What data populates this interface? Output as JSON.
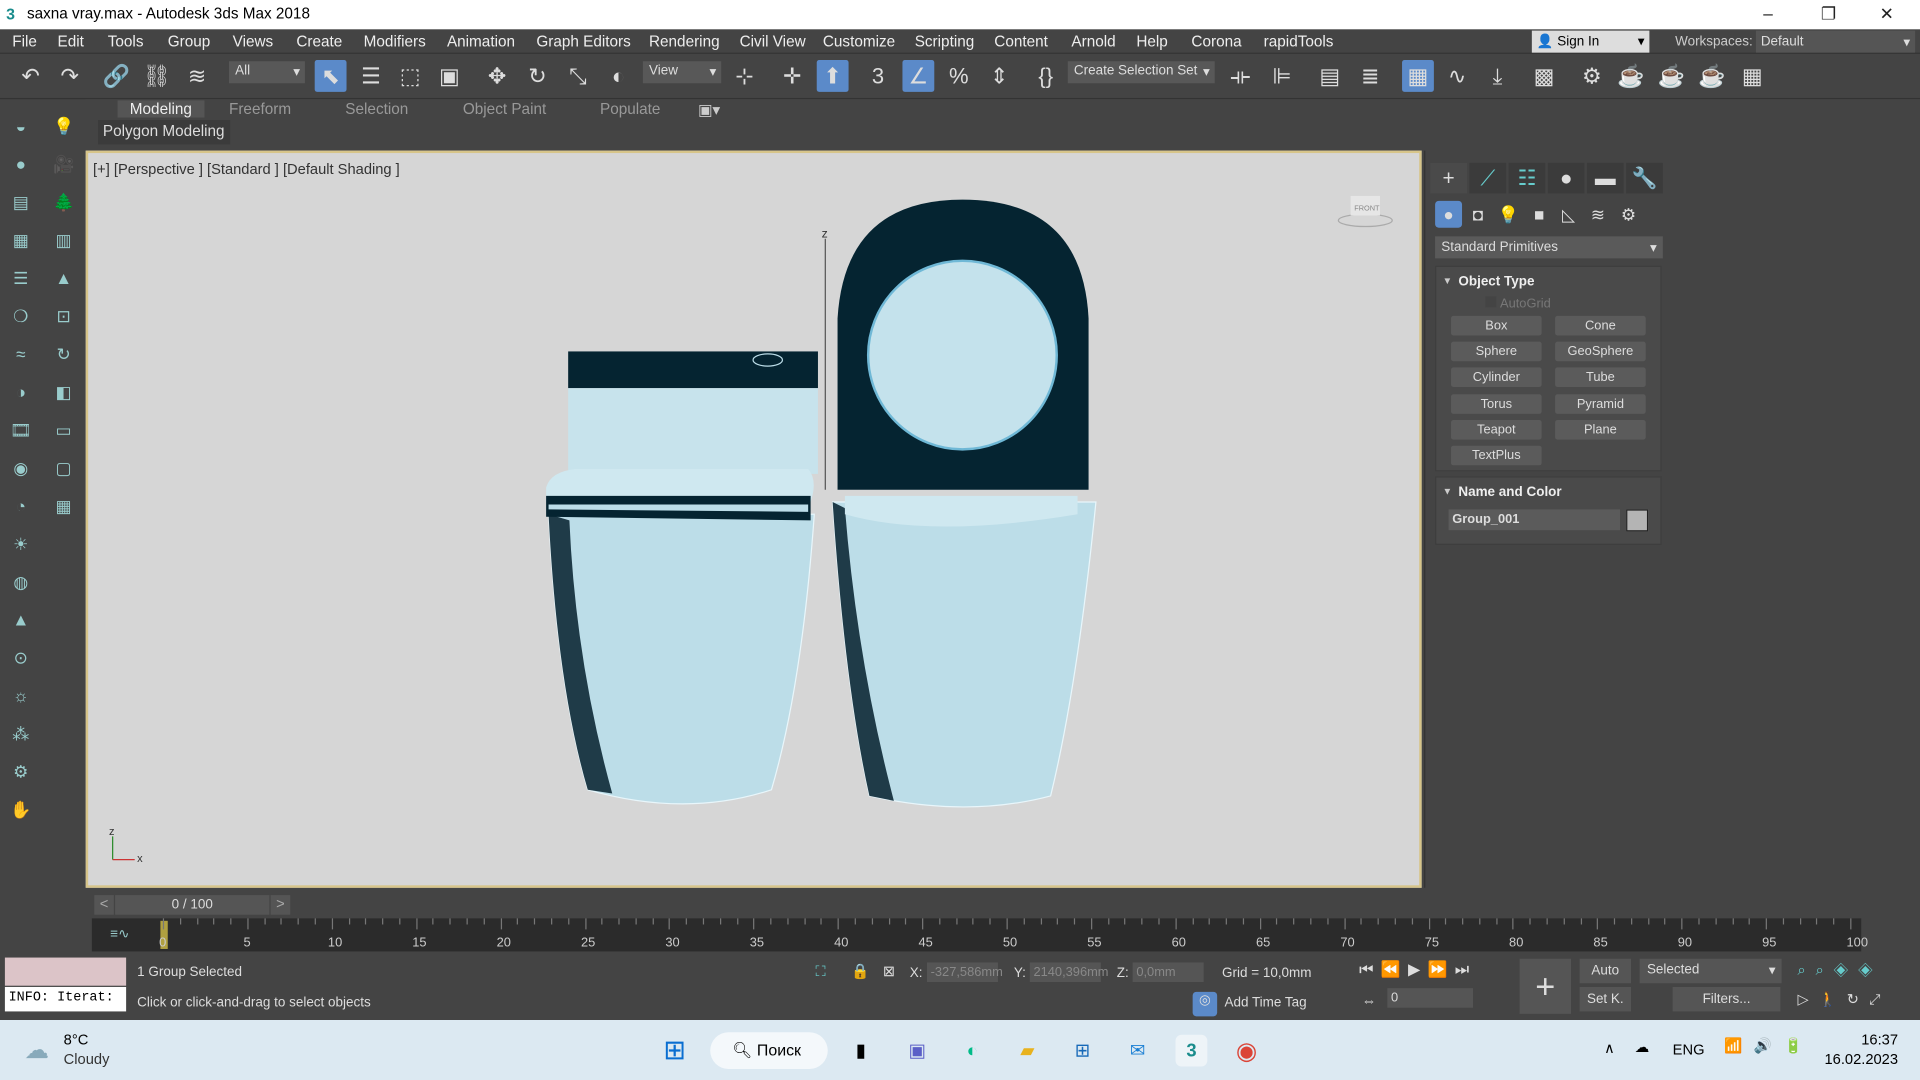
{
  "window": {
    "title": "saxna vray.max - Autodesk 3ds Max 2018",
    "minimize": "–",
    "restore": "❐",
    "close": "✕"
  },
  "menu": [
    "File",
    "Edit",
    "Tools",
    "Group",
    "Views",
    "Create",
    "Modifiers",
    "Animation",
    "Graph Editors",
    "Rendering",
    "Civil View",
    "Customize",
    "Scripting",
    "Content",
    "Arnold",
    "Help",
    "Corona",
    "rapidTools"
  ],
  "account": {
    "sign_in": "Sign In",
    "workspaces_label": "Workspaces:",
    "workspace": "Default"
  },
  "toolbar": {
    "filter": "All",
    "ref_coord": "View",
    "selection_set": "Create Selection Set"
  },
  "ribbon": {
    "tabs": [
      "Modeling",
      "Freeform",
      "Selection",
      "Object Paint",
      "Populate"
    ],
    "panel": "Polygon Modeling"
  },
  "viewport": {
    "label": "[+] [Perspective ] [Standard ] [Default Shading ]",
    "viewcube": "FRONT",
    "axis_z": "z",
    "axis_x": "x"
  },
  "command_panel": {
    "category": "Standard Primitives",
    "object_type": {
      "title": "Object Type",
      "autogrid": "AutoGrid",
      "buttons": [
        "Box",
        "Cone",
        "Sphere",
        "GeoSphere",
        "Cylinder",
        "Tube",
        "Torus",
        "Pyramid",
        "Teapot",
        "Plane",
        "TextPlus"
      ]
    },
    "name_color": {
      "title": "Name and Color",
      "name": "Group_001",
      "color": "#b4b4b4"
    }
  },
  "timeline": {
    "slider": "0 / 100",
    "prev": "<",
    "next": ">",
    "ticks": [
      "0",
      "5",
      "10",
      "15",
      "20",
      "25",
      "30",
      "35",
      "40",
      "45",
      "50",
      "55",
      "60",
      "65",
      "70",
      "75",
      "80",
      "85",
      "90",
      "95",
      "100"
    ]
  },
  "status": {
    "selection": "1 Group Selected",
    "prompt": "Click or click-and-drag to select objects",
    "script": "INFO: Iterat:",
    "x_label": "X:",
    "x": "-327,586mm",
    "y_label": "Y:",
    "y": "2140,396mm",
    "z_label": "Z:",
    "z": "0,0mm",
    "grid": "Grid = 10,0mm",
    "add_time_tag": "Add Time Tag",
    "frame": "0",
    "auto": "Auto",
    "set_key": "Set K.",
    "key_filter": "Selected",
    "filters": "Filters..."
  },
  "taskbar": {
    "temp": "8°C",
    "weather": "Cloudy",
    "search": "Поиск",
    "lang": "ENG",
    "time": "16:37",
    "date": "16.02.2023"
  },
  "colors": {
    "accent": "#5b8ac9",
    "viewport_bg": "#d6d6d6",
    "model": "#bcdde8",
    "model_dark": "#052431"
  }
}
